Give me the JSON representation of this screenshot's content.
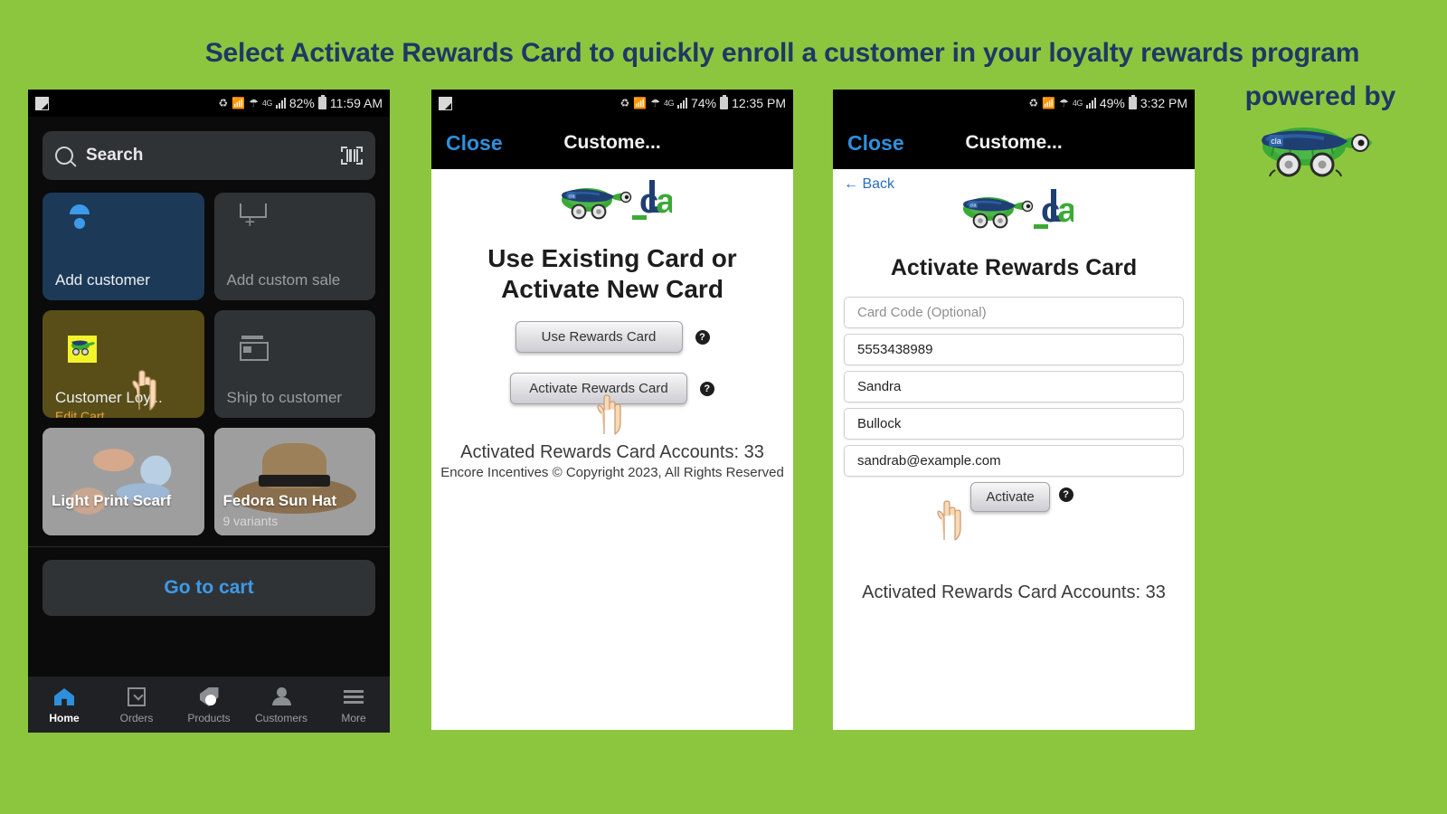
{
  "headline": "Select Activate Rewards Card to quickly enroll a customer in your loyalty rewards program",
  "powered_by": "powered by",
  "brand_colors": {
    "background_green": "#8CC63F",
    "headline_navy": "#1F3864",
    "link_blue": "#2E8FDC",
    "accent_orange": "#E8A33D",
    "logo_green": "#3AAA35",
    "logo_navy": "#1F3864"
  },
  "phone1": {
    "statusbar": {
      "app_icon": "flipp-app-icon",
      "icons": [
        "data-saver-icon",
        "bluetooth-icon",
        "wifi-icon"
      ],
      "network": "4G",
      "battery_percent": "82%",
      "time": "11:59 AM"
    },
    "search": {
      "placeholder": "Search",
      "search_icon": "search-icon",
      "scan_icon": "barcode-scan-icon"
    },
    "tiles": [
      {
        "label": "Add customer",
        "icon": "person-icon",
        "style": "primary"
      },
      {
        "label": "Add custom sale",
        "icon": "upload-box-icon",
        "style": "muted"
      },
      {
        "label": "Customer Loy...",
        "sublabel": "Edit Cart",
        "icon": "customer-loyalty-turtle-icon",
        "style": "loyalty"
      },
      {
        "label": "Ship to customer",
        "icon": "shipping-box-icon",
        "style": "muted"
      }
    ],
    "products": [
      {
        "name": "Light Print Scarf",
        "variants": ""
      },
      {
        "name": "Fedora Sun Hat",
        "variants": "9 variants"
      }
    ],
    "cart_button": "Go to cart",
    "tabs": [
      {
        "label": "Home",
        "icon": "home-icon",
        "active": true
      },
      {
        "label": "Orders",
        "icon": "orders-icon",
        "active": false
      },
      {
        "label": "Products",
        "icon": "tag-icon",
        "active": false
      },
      {
        "label": "Customers",
        "icon": "person-icon",
        "active": false
      },
      {
        "label": "More",
        "icon": "hamburger-icon",
        "active": false
      }
    ]
  },
  "phone2": {
    "statusbar": {
      "app_icon": "flipp-app-icon",
      "icons": [
        "data-saver-icon",
        "bluetooth-icon",
        "wifi-icon"
      ],
      "network": "4G",
      "battery_percent": "74%",
      "time": "12:35 PM"
    },
    "modal": {
      "close_label": "Close",
      "title": "Custome..."
    },
    "logo_alt": "cla-turtle-logo",
    "heading": "Use Existing Card or Activate New Card",
    "buttons": [
      {
        "label": "Use Rewards Card",
        "help": "help-icon"
      },
      {
        "label": "Activate Rewards Card",
        "help": "help-icon"
      }
    ],
    "accounts_line": "Activated Rewards Card Accounts: 33",
    "copyright": "Encore Incentives © Copyright 2023, All Rights Reserved"
  },
  "phone3": {
    "statusbar": {
      "app_icon": "flipp-app-icon",
      "icons": [
        "data-saver-icon",
        "bluetooth-icon",
        "wifi-icon"
      ],
      "network": "4G",
      "battery_percent": "49%",
      "time": "3:32 PM"
    },
    "modal": {
      "close_label": "Close",
      "title": "Custome..."
    },
    "back_label": "← Back",
    "logo_alt": "cla-turtle-logo",
    "heading": "Activate Rewards Card",
    "fields": [
      {
        "value": "Card Code (Optional)",
        "is_placeholder": true,
        "name": "card-code-field"
      },
      {
        "value": "5553438989",
        "is_placeholder": false,
        "name": "phone-field"
      },
      {
        "value": "Sandra",
        "is_placeholder": false,
        "name": "first-name-field"
      },
      {
        "value": "Bullock",
        "is_placeholder": false,
        "name": "last-name-field"
      },
      {
        "value": "sandrab@example.com",
        "is_placeholder": false,
        "name": "email-field"
      }
    ],
    "activate_button": "Activate",
    "help": "help-icon",
    "accounts_line": "Activated Rewards Card Accounts: 33"
  }
}
